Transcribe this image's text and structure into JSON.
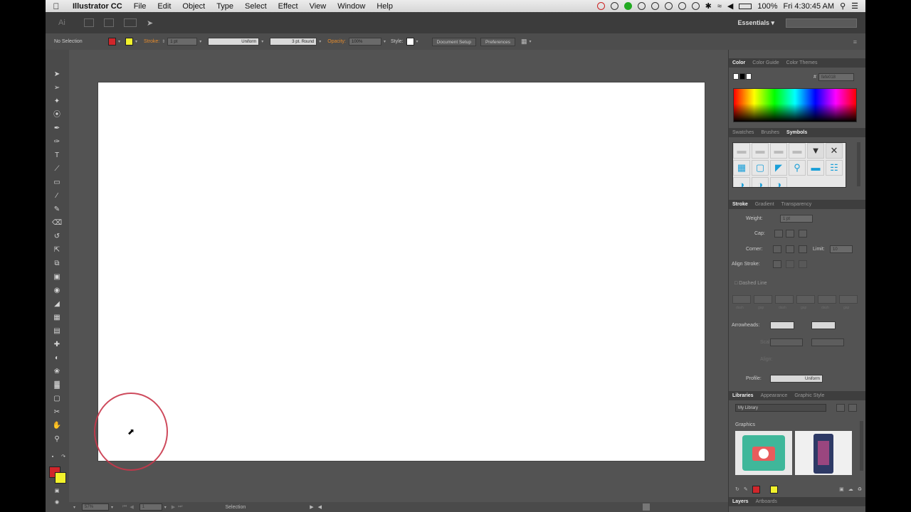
{
  "menubar": {
    "app_name": "Illustrator CC",
    "items": [
      "File",
      "Edit",
      "Object",
      "Type",
      "Select",
      "Effect",
      "View",
      "Window",
      "Help"
    ],
    "battery": "100%",
    "clock": "Fri 4:30:45 AM"
  },
  "appbar": {
    "logo": "Ai",
    "workspace": "Essentials"
  },
  "controlbar": {
    "selection": "No Selection",
    "stroke_label": "Stroke:",
    "stroke_value": "1 pt",
    "profile_value": "Uniform",
    "brush_value": "3 pt. Round",
    "opacity_label": "Opacity:",
    "opacity_value": "100%",
    "style_label": "Style:",
    "doc_setup": "Document Setup",
    "preferences": "Preferences",
    "fill_color": "#d0262b",
    "stroke_color": "#f2f22c"
  },
  "color_panel": {
    "tabs": [
      "Color",
      "Color Guide",
      "Color Themes"
    ],
    "hex_label": "#",
    "hex_value": "fefe018"
  },
  "swatches_panel": {
    "tabs": [
      "Swatches",
      "Brushes",
      "Symbols"
    ]
  },
  "stroke_panel": {
    "tabs": [
      "Stroke",
      "Gradient",
      "Transparency"
    ],
    "weight_label": "Weight:",
    "weight_value": "1 pt",
    "cap_label": "Cap:",
    "corner_label": "Corner:",
    "limit_label": "Limit:",
    "limit_value": "10",
    "align_label": "Align Stroke:",
    "dashed_label": "Dashed Line",
    "dash_labels": [
      "dash",
      "gap",
      "dash",
      "gap",
      "dash",
      "gap"
    ],
    "arrowheads_label": "Arrowheads:",
    "scale_label": "Scale:",
    "align_arrow_label": "Align:",
    "profile_label": "Profile:",
    "profile_value": "Uniform"
  },
  "libraries_panel": {
    "tabs": [
      "Libraries",
      "Appearance",
      "Graphic Style"
    ],
    "library_name": "My Library",
    "section_label": "Graphics"
  },
  "layers_panel": {
    "tabs": [
      "Layers",
      "Artboards"
    ]
  },
  "statusbar": {
    "zoom": "57%",
    "artboard_num": "1",
    "tool_name": "Selection"
  }
}
